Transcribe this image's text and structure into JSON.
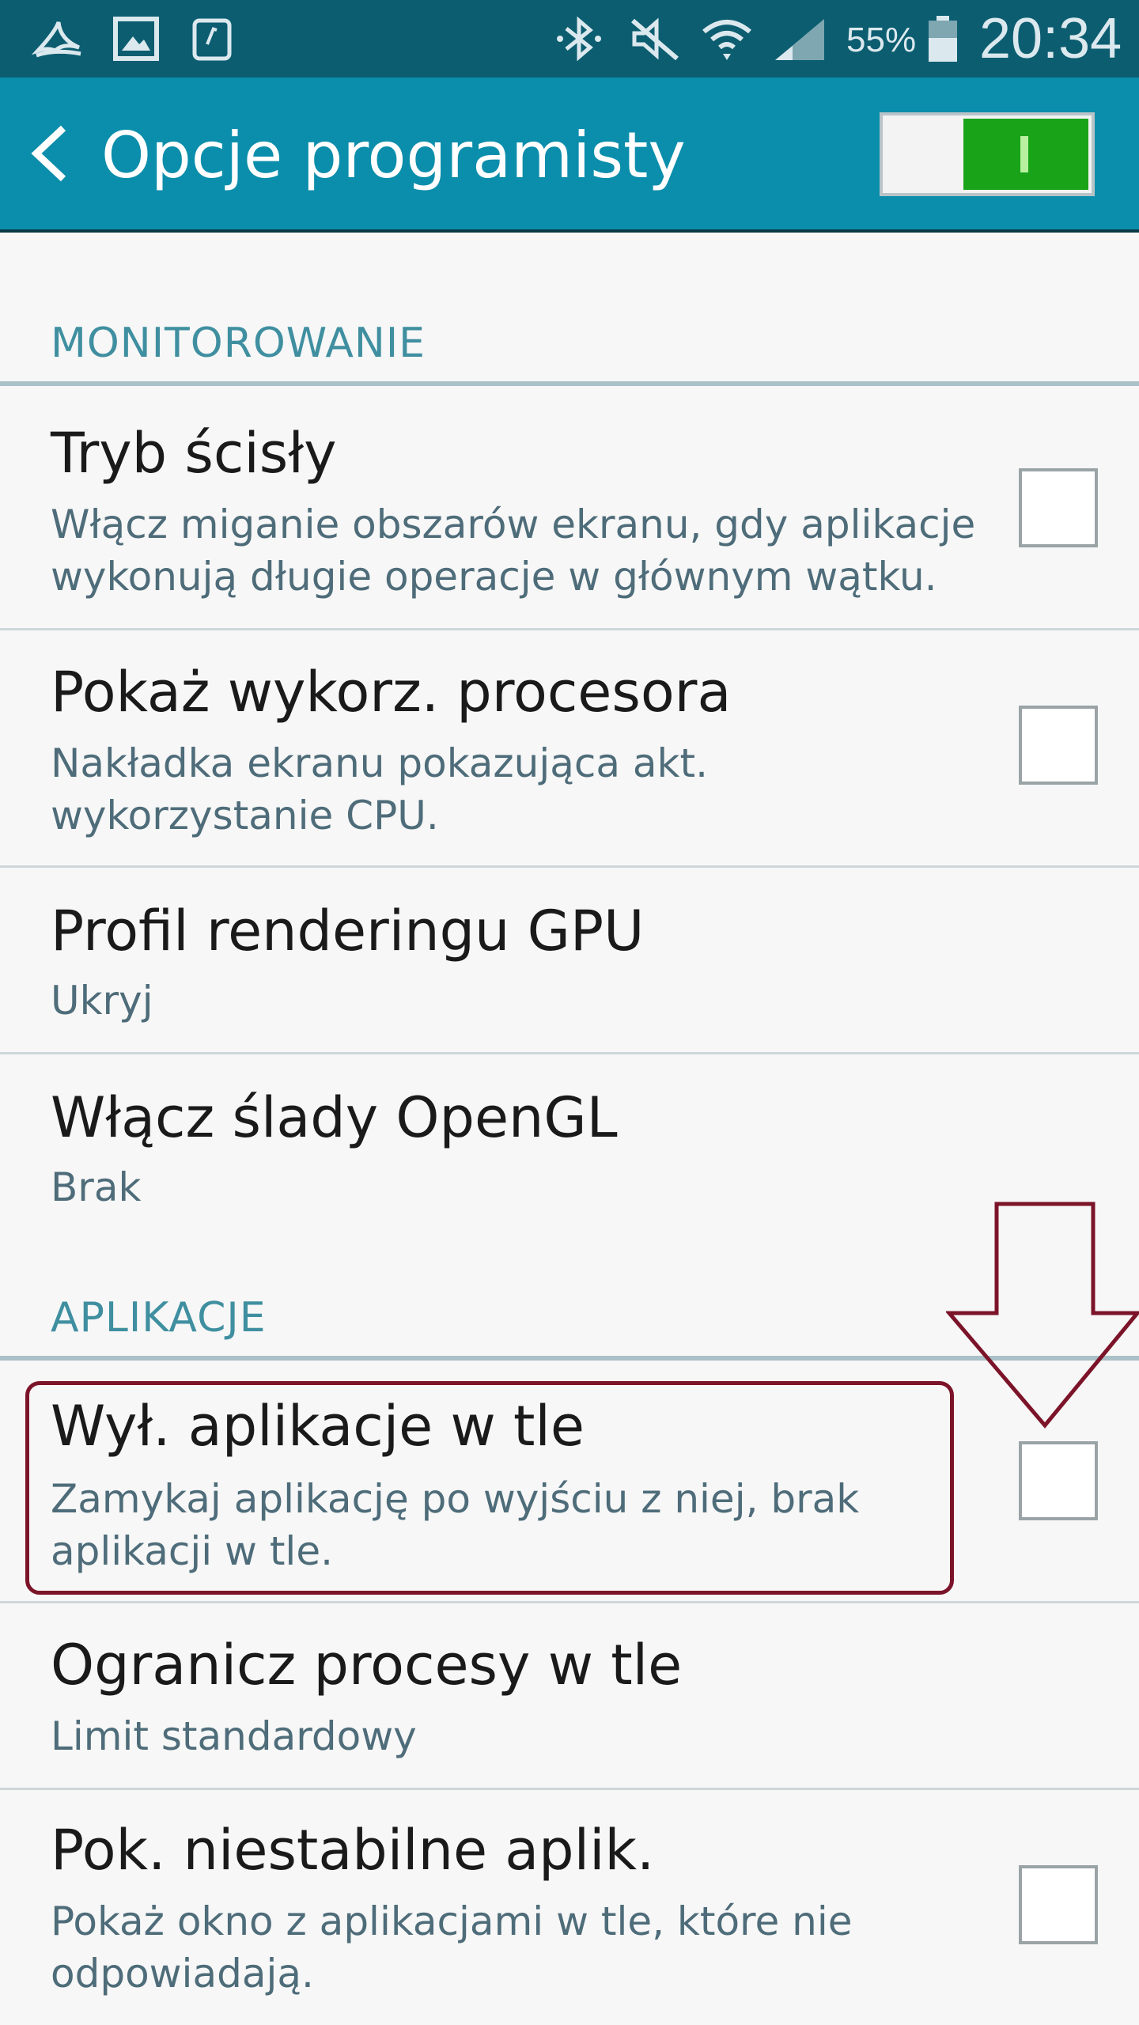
{
  "status_bar": {
    "battery": "55%",
    "time": "20:34",
    "icons": [
      "app-notification-icon",
      "gallery-icon",
      "tablet-icon",
      "bluetooth-icon",
      "mute-icon",
      "wifi-icon",
      "signal-icon",
      "battery-icon"
    ]
  },
  "action_bar": {
    "title": "Opcje programisty",
    "master_switch_on": true
  },
  "sections": [
    {
      "header": "MONITOROWANIE",
      "items": [
        {
          "title": "Tryb ścisły",
          "summary": "Włącz miganie obszarów ekranu, gdy aplikacje wykonują długie operacje w głównym wątku.",
          "checked": false
        },
        {
          "title": "Pokaż wykorz. procesora",
          "summary": "Nakładka ekranu pokazująca akt. wykorzystanie CPU.",
          "checked": false
        },
        {
          "title": "Profil renderingu GPU",
          "summary": "Ukryj"
        },
        {
          "title": "Włącz ślady OpenGL",
          "summary": "Brak"
        }
      ]
    },
    {
      "header": "APLIKACJE",
      "items": [
        {
          "title": "Wył. aplikacje w tle",
          "summary": "Zamykaj aplikację po wyjściu z niej, brak aplikacji w tle.",
          "checked": false
        },
        {
          "title": "Ogranicz procesy w tle",
          "summary": "Limit standardowy"
        },
        {
          "title": "Pok. niestabilne aplik.",
          "summary": "Pokaż okno z aplikacjami w tle, które nie odpowiadają.",
          "checked": false
        }
      ]
    }
  ],
  "colors": {
    "status_bar": "#0c5d70",
    "action_bar": "#0b8eab",
    "section_header": "#3f8fa0",
    "switch_on": "#19a319",
    "annotation": "#7c1429"
  }
}
